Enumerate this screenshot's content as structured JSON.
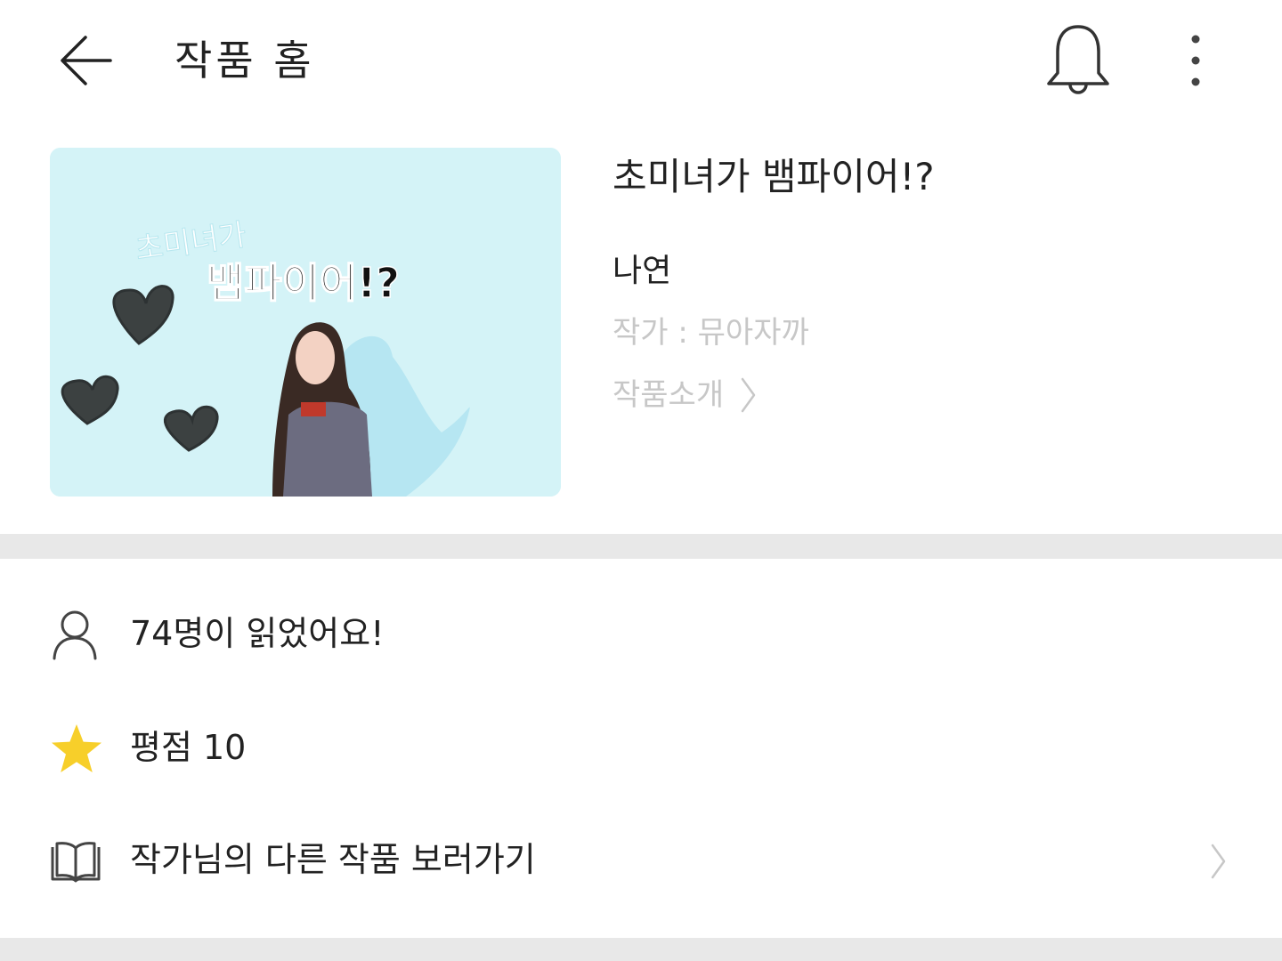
{
  "header": {
    "title": "작품 홈",
    "back_icon": "arrow-left-icon",
    "bell_icon": "bell-icon",
    "more_icon": "more-vertical-icon"
  },
  "work": {
    "cover_title_small": "초미녀가",
    "cover_title_main": "뱀파이어!?",
    "title": "초미녀가 뱀파이어!?",
    "subtitle": "나연",
    "author": "작가 : 뮤아자까",
    "intro_label": "작품소개",
    "cover_bg_color": "#d4f3f7"
  },
  "stats": {
    "readers": "74명이 읽었어요!",
    "rating": "평점 10",
    "other_works": "작가님의 다른 작품 보러가기"
  },
  "colors": {
    "star": "#f7cf2a",
    "muted_text": "#c7c7c7",
    "divider": "#e8e8e8"
  }
}
